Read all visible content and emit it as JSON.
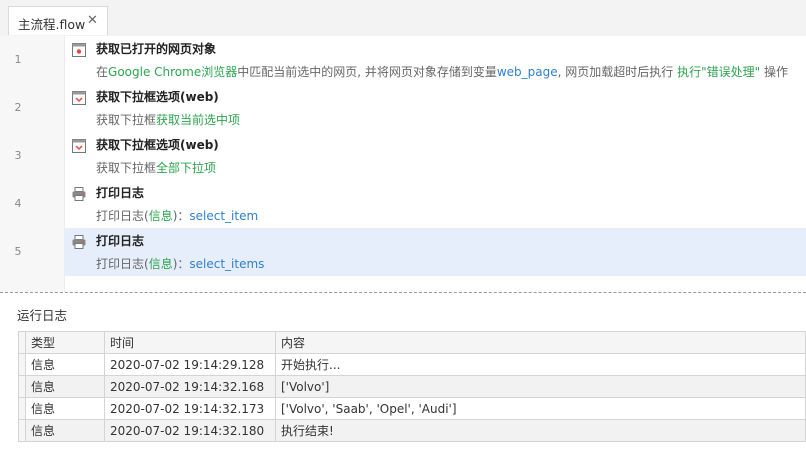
{
  "tab": {
    "label": "主流程.flow",
    "close": "✕"
  },
  "steps": [
    {
      "line": "1",
      "icon": "browser-icon",
      "title": "获取已打开的网页对象",
      "desc": [
        {
          "t": "在",
          "c": "plain"
        },
        {
          "t": "Google Chrome浏览器",
          "c": "kw"
        },
        {
          "t": "中匹配当前选中的网页, 并将网页对象存储到变量",
          "c": "plain"
        },
        {
          "t": "web_page",
          "c": "var"
        },
        {
          "t": ", 网页加载超时后执行 ",
          "c": "plain"
        },
        {
          "t": "执行\"错误处理\"",
          "c": "kw"
        },
        {
          "t": " 操作",
          "c": "plain"
        }
      ]
    },
    {
      "line": "2",
      "icon": "dropdown-icon",
      "title": "获取下拉框选项(web)",
      "desc": [
        {
          "t": "获取下拉框",
          "c": "plain"
        },
        {
          "t": "获取当前选中项",
          "c": "kw"
        }
      ]
    },
    {
      "line": "3",
      "icon": "dropdown-icon",
      "title": "获取下拉框选项(web)",
      "desc": [
        {
          "t": "获取下拉框",
          "c": "plain"
        },
        {
          "t": "全部下拉项",
          "c": "kw"
        }
      ]
    },
    {
      "line": "4",
      "icon": "printer-icon",
      "title": "打印日志",
      "desc": [
        {
          "t": "打印日志(",
          "c": "plain"
        },
        {
          "t": "信息",
          "c": "kw"
        },
        {
          "t": ")：",
          "c": "plain"
        },
        {
          "t": "select_item",
          "c": "var"
        }
      ]
    },
    {
      "line": "5",
      "icon": "printer-icon",
      "title": "打印日志",
      "selected": true,
      "desc": [
        {
          "t": "打印日志(",
          "c": "plain"
        },
        {
          "t": "信息",
          "c": "kw"
        },
        {
          "t": ")：",
          "c": "plain"
        },
        {
          "t": "select_items",
          "c": "var"
        }
      ]
    }
  ],
  "log": {
    "title": "运行日志",
    "columns": [
      "类型",
      "时间",
      "内容"
    ],
    "rows": [
      [
        "信息",
        "2020-07-02 19:14:29.128",
        "开始执行..."
      ],
      [
        "信息",
        "2020-07-02 19:14:32.168",
        "['Volvo']"
      ],
      [
        "信息",
        "2020-07-02 19:14:32.173",
        "['Volvo', 'Saab', 'Opel', 'Audi']"
      ],
      [
        "信息",
        "2020-07-02 19:14:32.180",
        "执行结束!"
      ]
    ]
  },
  "colors": {
    "keyword": "#2ea44f",
    "variable": "#2f7fcf",
    "selected_row": "#e6eefb"
  }
}
